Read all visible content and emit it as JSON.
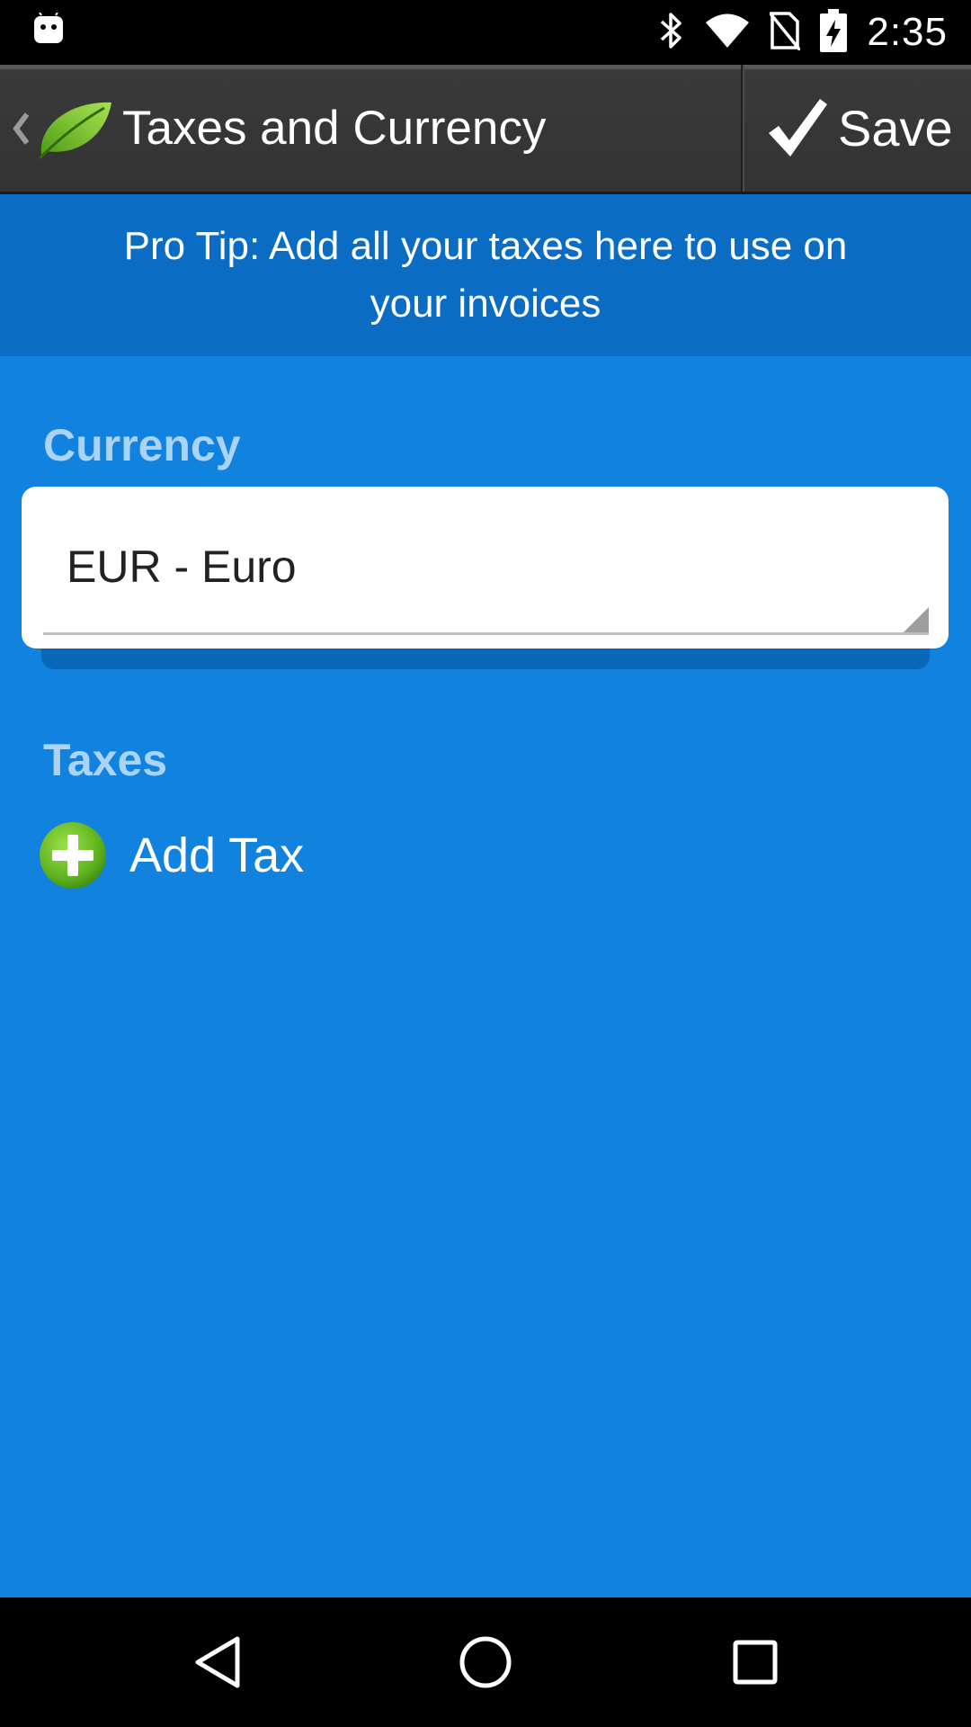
{
  "status_bar": {
    "time": "2:35",
    "icons": [
      "android-icon",
      "bluetooth-icon",
      "wifi-icon",
      "no-sim-icon",
      "battery-charging-icon"
    ]
  },
  "action_bar": {
    "title": "Taxes and Currency",
    "save_label": "Save",
    "icons": [
      "chevron-left-icon",
      "leaf-logo-icon",
      "checkmark-icon"
    ]
  },
  "tip": {
    "text": "Pro Tip: Add all your taxes here to use on your invoices"
  },
  "currency": {
    "section_label": "Currency",
    "selected_value": "EUR - Euro"
  },
  "taxes": {
    "section_label": "Taxes",
    "add_label": "Add Tax"
  },
  "nav_bar": {
    "icons": [
      "nav-back-icon",
      "nav-home-icon",
      "nav-recents-icon"
    ]
  },
  "colors": {
    "content_background": "#1183de",
    "tip_background": "#0a6cc2",
    "section_label": "#a9d4f7",
    "action_bar": "#333333",
    "add_icon_green": "#5fb31e"
  }
}
